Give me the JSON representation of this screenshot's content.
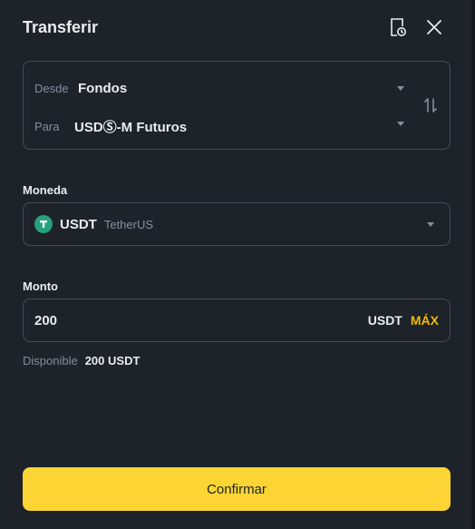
{
  "header": {
    "title": "Transferir"
  },
  "transfer": {
    "from_label": "Desde",
    "from_value": "Fondos",
    "to_label": "Para",
    "to_value": "USDⓈ-M Futuros"
  },
  "coin": {
    "label": "Moneda",
    "symbol": "USDT",
    "name": "TetherUS",
    "icon_color": "#26a17b"
  },
  "amount": {
    "label": "Monto",
    "value": "200",
    "unit": "USDT",
    "max_label": "MÁX"
  },
  "available": {
    "label": "Disponible",
    "value": "200 USDT"
  },
  "confirm_label": "Confirmar",
  "colors": {
    "accent": "#fcd535",
    "max": "#f0b90b",
    "background": "#1e2329",
    "border": "#474d57"
  },
  "icons": {
    "history": "history-doc-icon",
    "close": "close-icon",
    "swap": "swap-arrows-icon"
  }
}
